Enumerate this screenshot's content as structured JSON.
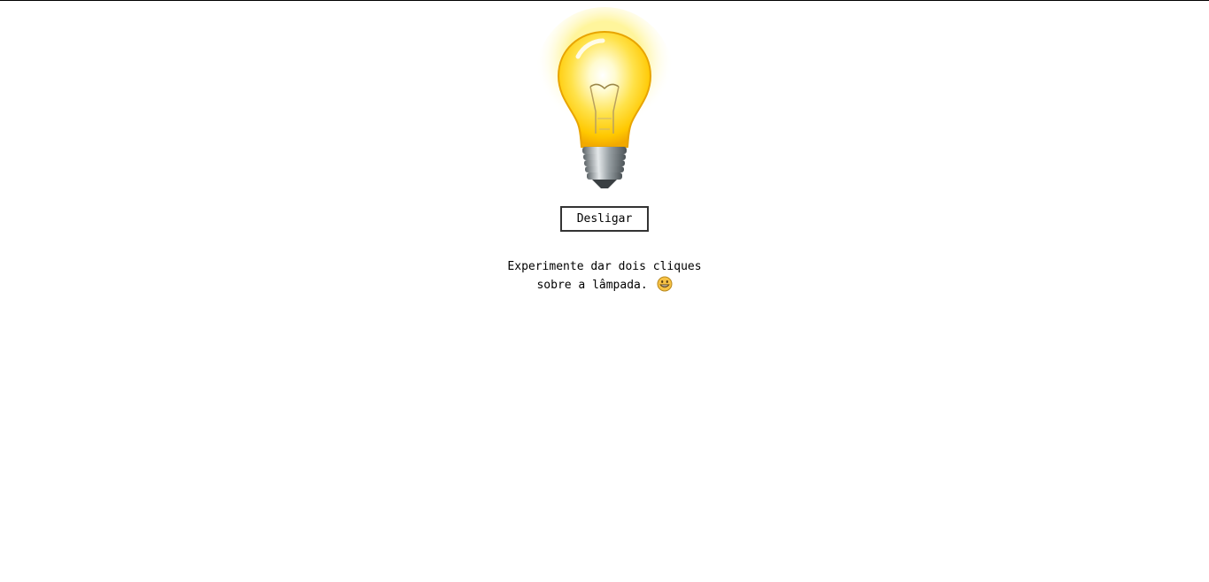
{
  "bulb": {
    "state": "on",
    "glow_color": "#FFF27A",
    "glass_color": "#FFD700"
  },
  "toggle_button": {
    "label": "Desligar"
  },
  "hint": {
    "line1": "Experimente dar dois cliques",
    "line2": "sobre a lâmpada.",
    "emoji_icon": "grinning-face-icon"
  }
}
